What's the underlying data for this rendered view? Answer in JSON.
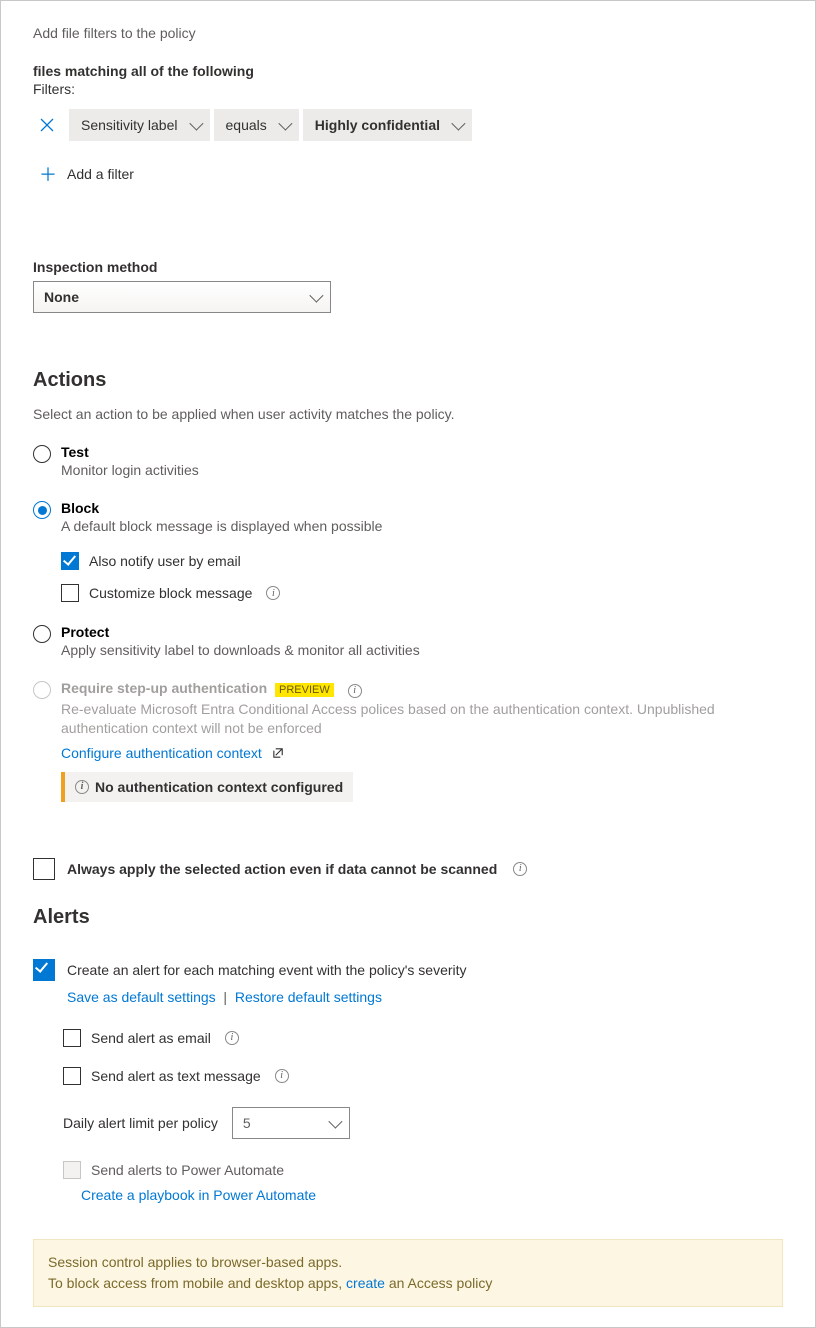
{
  "filters": {
    "intro": "Add file filters to the policy",
    "matching": "files matching all of the following",
    "label": "Filters:",
    "pill_attribute": "Sensitivity label",
    "pill_operator": "equals",
    "pill_value": "Highly confidential",
    "add_filter": "Add a filter"
  },
  "inspection": {
    "label": "Inspection method",
    "value": "None"
  },
  "actions": {
    "heading": "Actions",
    "description": "Select an action to be applied when user activity matches the policy.",
    "test": {
      "label": "Test",
      "sub": "Monitor login activities"
    },
    "block": {
      "label": "Block",
      "sub": "A default block message is displayed when possible",
      "notify": "Also notify user by email",
      "customize": "Customize block message"
    },
    "protect": {
      "label": "Protect",
      "sub": "Apply sensitivity label to downloads & monitor all activities"
    },
    "stepup": {
      "label": "Require step-up authentication",
      "badge": "PREVIEW",
      "sub": "Re-evaluate Microsoft Entra Conditional Access polices based on the authentication context. Unpublished authentication context will not be enforced",
      "configure": "Configure authentication context",
      "warning": "No authentication context configured"
    },
    "always_apply": "Always apply the selected action even if data cannot be scanned"
  },
  "alerts": {
    "heading": "Alerts",
    "create": "Create an alert for each matching event with the policy's severity",
    "save_defaults": "Save as default settings",
    "restore_defaults": "Restore default settings",
    "send_email": "Send alert as email",
    "send_text": "Send alert as text message",
    "daily_limit_label": "Daily alert limit per policy",
    "daily_limit_value": "5",
    "power_automate": "Send alerts to Power Automate",
    "playbook_link": "Create a playbook in Power Automate"
  },
  "footer": {
    "line1": "Session control applies to browser-based apps.",
    "line2a": "To block access from mobile and desktop apps, ",
    "link": "create",
    "line2b": " an Access policy"
  }
}
